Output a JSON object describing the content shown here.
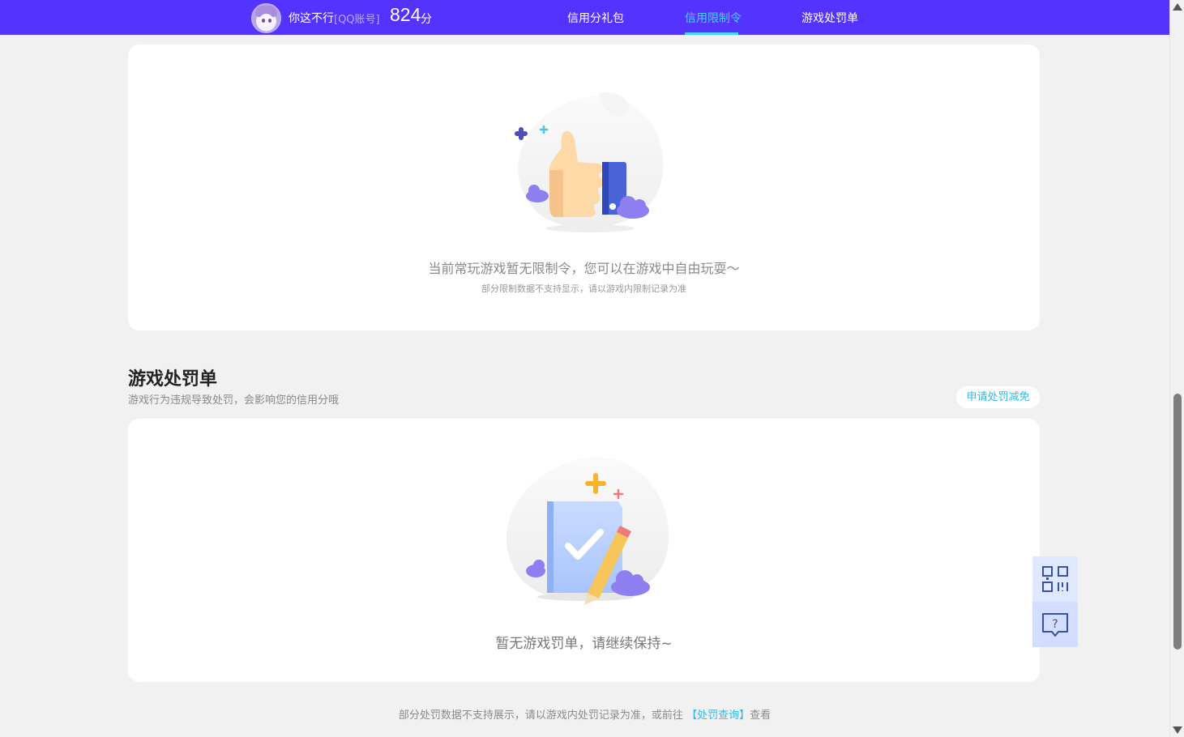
{
  "header": {
    "username": "你这不行",
    "account_type": "[QQ账号]",
    "score": "824",
    "score_unit": "分",
    "nav": [
      {
        "label": "信用分礼包",
        "active": false
      },
      {
        "label": "信用限制令",
        "active": true
      },
      {
        "label": "游戏处罚单",
        "active": false
      }
    ],
    "brand_color": "#5533ff",
    "active_color": "#41d7f5"
  },
  "restriction_card": {
    "illustration": "thumbs-up-icon",
    "empty_text": "当前常玩游戏暂无限制令，您可以在游戏中自由玩耍～",
    "note": "部分限制数据不支持显示，请以游戏内限制记录为准"
  },
  "penalty_section": {
    "title": "游戏处罚单",
    "subtitle": "游戏行为违规导致处罚，会影响您的信用分哦",
    "apply_button": "申请处罚减免",
    "illustration": "checklist-pencil-icon",
    "empty_text": "暂无游戏罚单，请继续保持~"
  },
  "footer": {
    "note_prefix": "部分处罚数据不支持展示，请以游戏内处罚记录为准，或前往",
    "link": "【处罚查询】",
    "note_suffix": "查看"
  },
  "floating": {
    "qr_icon": "qr-code-icon",
    "help_icon": "help-chat-icon"
  }
}
